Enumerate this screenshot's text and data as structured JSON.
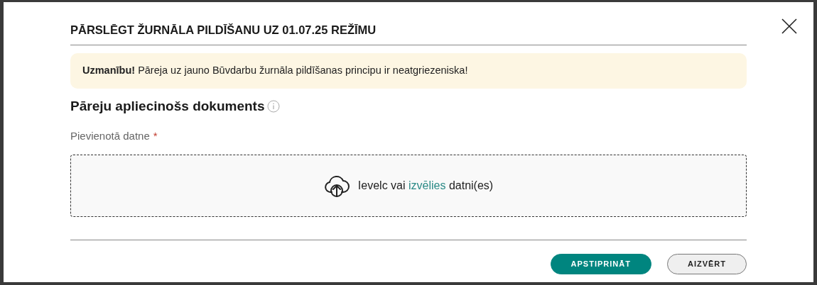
{
  "dialog": {
    "title": "PĀRSLĒGT ŽURNĀLA PILDĪŠANU UZ 01.07.25 REŽĪMU",
    "alert": "**Uzmanību!** Pāreja uz jauno Būvdarbu žurnāla pildīšanas principu ir neatgriezeniska!",
    "section_heading": "Pāreju apliecinošs dokuments",
    "field_label": "Pievienotā datne",
    "required_mark": "*",
    "dropzone": {
      "text_before": "Ievelc vai",
      "link": "izvēlies",
      "text_after": "datni(es)"
    },
    "buttons": [
      {
        "label": "APSTIPRINĀT",
        "kind": "primary"
      },
      {
        "label": "AIZVĒRT",
        "kind": "secondary"
      }
    ]
  }
}
